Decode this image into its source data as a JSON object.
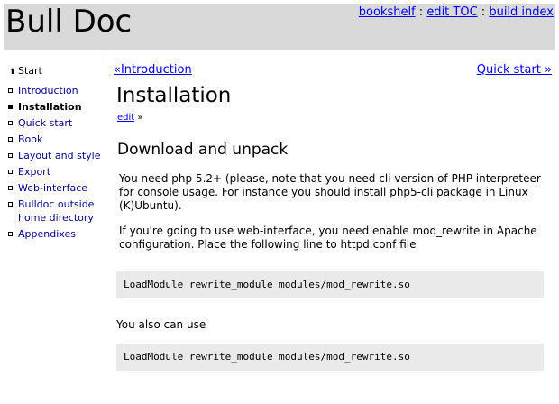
{
  "header": {
    "title": "Bull Doc",
    "nav": [
      {
        "label": "bookshelf"
      },
      {
        "label": "edit TOC"
      },
      {
        "label": "build index"
      }
    ],
    "separator": ":"
  },
  "sidebar": {
    "start_label": "Start",
    "items": [
      {
        "label": "Introduction"
      },
      {
        "label": "Installation"
      },
      {
        "label": "Quick start"
      },
      {
        "label": "Book"
      },
      {
        "label": "Layout and style"
      },
      {
        "label": "Export"
      },
      {
        "label": "Web-interface"
      },
      {
        "label": "Bulldoc outside home directory"
      },
      {
        "label": "Appendixes"
      }
    ]
  },
  "content": {
    "prev_link": "«Introduction",
    "next_link": "Quick start »",
    "title": "Installation",
    "edit_label": "edit",
    "edit_suffix": "»",
    "section_heading": "Download and unpack",
    "para1": "You need php 5.2+ (please, note that you need cli version of PHP interpreteer for console usage. For instance you should install php5-cli package in Linux (K)Ubuntu).",
    "para2": "If you're going to use web-interface, you need enable mod_rewrite in Apache configuration. Place the following line to httpd.conf file",
    "code1": "LoadModule rewrite_module modules/mod_rewrite.so",
    "also_text": "You also can use",
    "code2": "LoadModule rewrite_module modules/mod_rewrite.so"
  }
}
